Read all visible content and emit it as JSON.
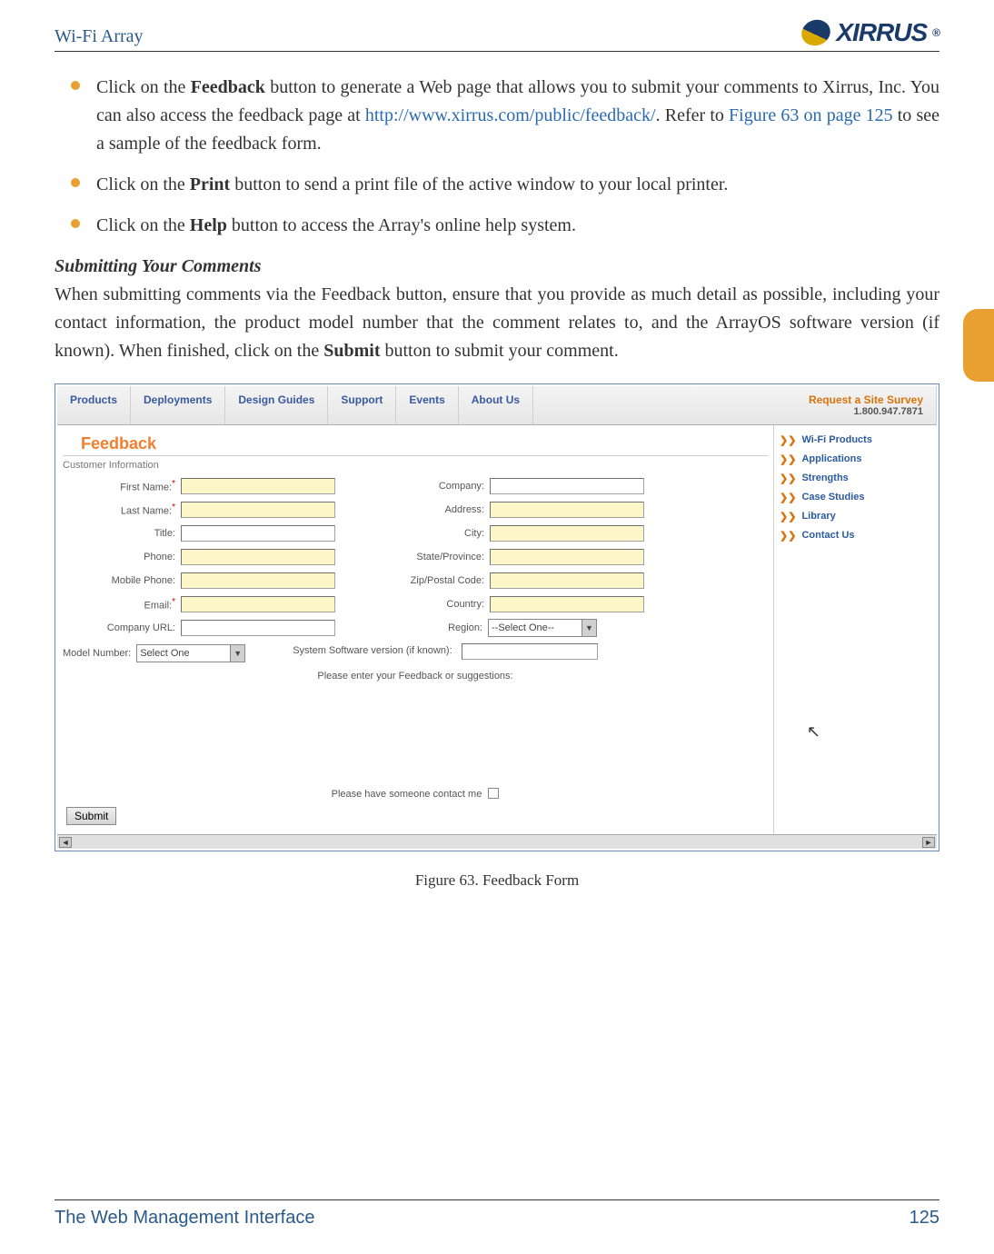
{
  "header": {
    "title": "Wi-Fi Array",
    "logo_text": "XIRRUS",
    "logo_mark": "®"
  },
  "bullets": [
    {
      "pre": "Click on the ",
      "bold": "Feedback",
      "post": " button to generate a Web page that allows you to submit your comments to Xirrus, Inc. You can also access the feedback page at ",
      "link1": "http://www.xirrus.com/public/feedback/",
      "mid": ". Refer to ",
      "link2": "Figure 63 on page 125",
      "tail": " to see a sample of the feedback form."
    },
    {
      "pre": "Click on the ",
      "bold": "Print",
      "post": " button to send a print file of the active window to your local printer."
    },
    {
      "pre": "Click on the ",
      "bold": "Help",
      "post": " button to access the Array's online help system."
    }
  ],
  "section": {
    "heading": "Submitting Your Comments",
    "body_pre": "When submitting comments via the Feedback button, ensure that you provide as much detail as possible, including your contact information, the product model number that the comment relates to, and the ArrayOS software version (if known). When finished, click on the ",
    "body_bold": "Submit",
    "body_post": " button to submit your comment."
  },
  "figure": {
    "nav": [
      "Products",
      "Deployments",
      "Design Guides",
      "Support",
      "Events",
      "About Us"
    ],
    "cta": "Request a Site Survey",
    "phone": "1.800.947.7871",
    "title": "Feedback",
    "cust_info": "Customer Information",
    "left_labels": [
      "First Name:",
      "Last Name:",
      "Title:",
      "Phone:",
      "Mobile Phone:",
      "Email:",
      "Company URL:"
    ],
    "left_required": [
      true,
      true,
      false,
      false,
      false,
      true,
      false
    ],
    "right_labels": [
      "Company:",
      "Address:",
      "City:",
      "State/Province:",
      "Zip/Postal Code:",
      "Country:",
      "Region:"
    ],
    "model_label": "Model Number:",
    "model_value": "Select One",
    "sw_label": "System Software version (if known):",
    "region_value": "--Select One--",
    "feedback_prompt": "Please enter your Feedback or suggestions:",
    "contact_prompt": "Please have someone contact me",
    "submit": "Submit",
    "sidebar": [
      "Wi-Fi Products",
      "Applications",
      "Strengths",
      "Case Studies",
      "Library",
      "Contact Us"
    ],
    "caption": "Figure 63. Feedback Form"
  },
  "footer": {
    "left": "The Web Management Interface",
    "right": "125"
  }
}
